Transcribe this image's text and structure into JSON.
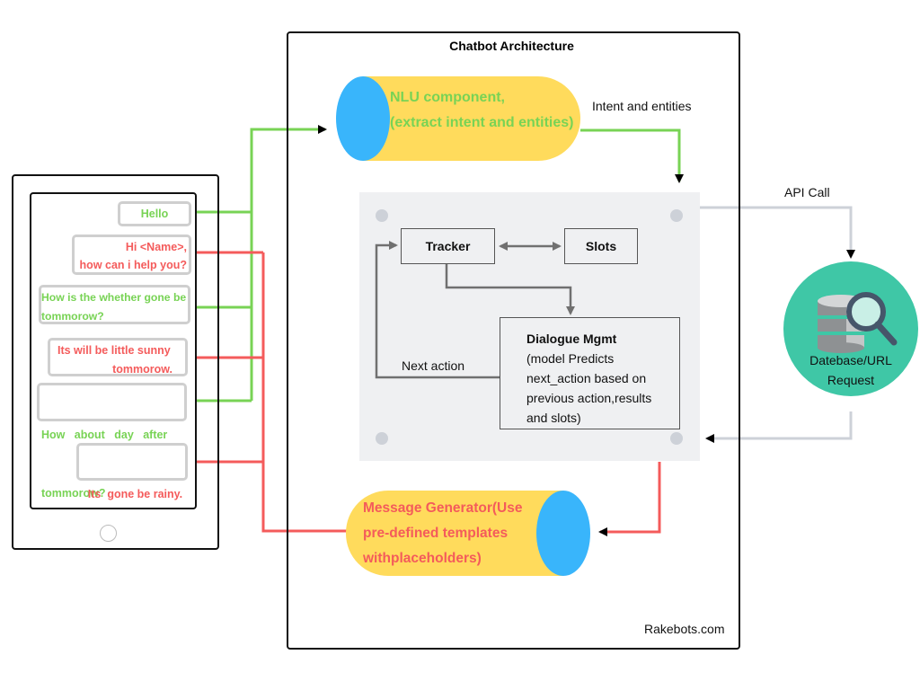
{
  "diagram": {
    "title": "Chatbot Architecture",
    "watermark": "Rakebots.com",
    "colors": {
      "user_message": "#78d355",
      "bot_message": "#f45b5b",
      "cylinder_body": "#ffdb5c",
      "cylinder_cap": "#39b5fb",
      "database_circle": "#3fc7a6",
      "core_panel": "#eff0f2",
      "api_line": "#cdd1d8",
      "internal_arrow": "#707070"
    }
  },
  "phone": {
    "messages": [
      {
        "sender": "user",
        "lines": [
          "Hello"
        ]
      },
      {
        "sender": "bot",
        "lines": [
          "Hi <Name>,",
          "how can i help you?"
        ]
      },
      {
        "sender": "user",
        "lines": [
          "How is the whether gone be",
          "tommorow?"
        ]
      },
      {
        "sender": "bot",
        "lines": [
          "Its  will be little sunny",
          "tommorow."
        ]
      },
      {
        "sender": "user",
        "lines": [
          "How   about   day   after",
          "tommorow?"
        ]
      },
      {
        "sender": "bot",
        "lines": [
          "Its  gone be rainy."
        ]
      }
    ],
    "home_button": "home-button"
  },
  "nlu": {
    "lines": [
      "NLU component,",
      "(extract intent and entities)"
    ]
  },
  "labels": {
    "intent_entities": "Intent and entities",
    "api_call": "API Call",
    "next_action": "Next action"
  },
  "core": {
    "tracker": "Tracker",
    "slots": "Slots",
    "dialogue_title": "Dialogue Mgmt",
    "dialogue_lines": [
      "(model Predicts",
      "next_action based on",
      "previous action,results",
      "and slots)"
    ]
  },
  "database": {
    "lines": [
      "Datebase/URL",
      "Request"
    ]
  },
  "message_generator": {
    "lines": [
      "Message Generator(Use",
      "pre-defined templates",
      "withplaceholders)"
    ]
  }
}
